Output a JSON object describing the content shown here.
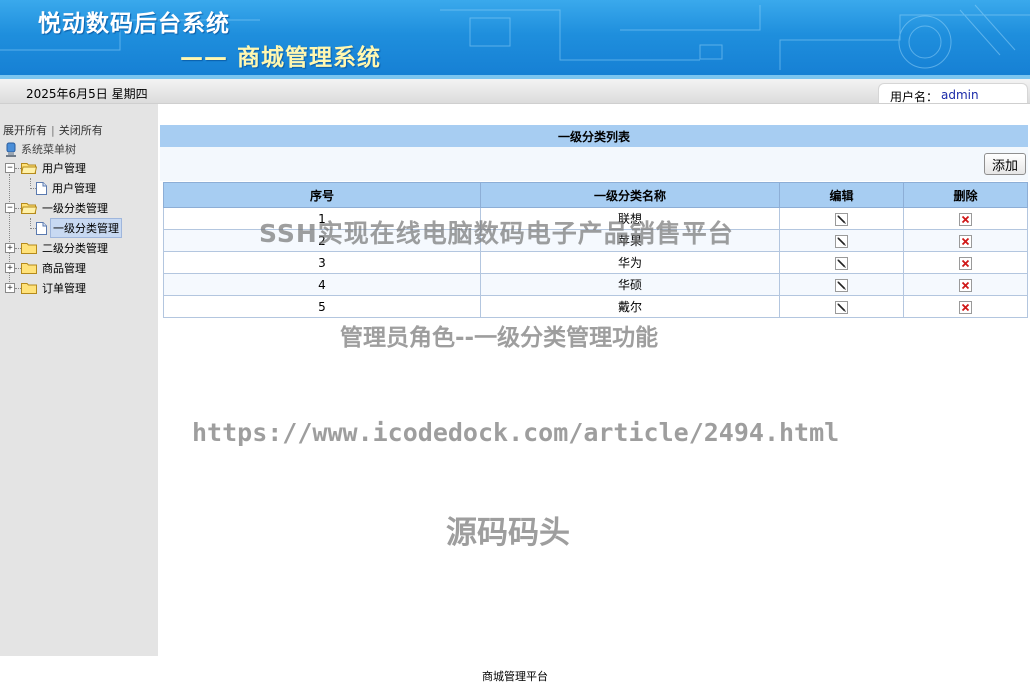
{
  "header": {
    "title": "悦动数码后台系统",
    "subtitle": "—— 商城管理系统"
  },
  "infobar": {
    "date": "2025年6月5日 星期四",
    "user_label": "用户名：",
    "user_name": "admin"
  },
  "sidebar": {
    "expand_all": "展开所有",
    "separator": "|",
    "collapse_all": "关闭所有",
    "root_label": "系统菜单树",
    "groups": [
      {
        "label": "用户管理",
        "expanded": true,
        "children": [
          "用户管理"
        ]
      },
      {
        "label": "一级分类管理",
        "expanded": true,
        "children": [
          "一级分类管理"
        ]
      },
      {
        "label": "二级分类管理",
        "expanded": false,
        "children": []
      },
      {
        "label": "商品管理",
        "expanded": false,
        "children": []
      },
      {
        "label": "订单管理",
        "expanded": false,
        "children": []
      }
    ],
    "selected": "一级分类管理"
  },
  "main": {
    "panel_title": "一级分类列表",
    "add_label": "添加",
    "columns": [
      "序号",
      "一级分类名称",
      "编辑",
      "删除"
    ],
    "rows": [
      {
        "id": "1",
        "name": "联想"
      },
      {
        "id": "2",
        "name": "苹果"
      },
      {
        "id": "3",
        "name": "华为"
      },
      {
        "id": "4",
        "name": "华硕"
      },
      {
        "id": "5",
        "name": "戴尔"
      }
    ]
  },
  "watermarks": [
    "SSH实现在线电脑数码电子产品销售平台",
    "管理员角色--一级分类管理功能",
    "https://www.icodedock.com/article/2494.html",
    "源码码头"
  ],
  "footer": {
    "text": "商城管理平台"
  },
  "colors": {
    "banner": "#1f8fdd",
    "header_row": "#a7cdf2",
    "sidebar": "#e4e4e4",
    "delete_red": "#d01818"
  },
  "icons": {
    "edit": "pencil-edit-icon",
    "delete": "red-x-delete-icon",
    "folder": "folder-icon",
    "page": "page-icon",
    "root": "tree-root-icon"
  }
}
